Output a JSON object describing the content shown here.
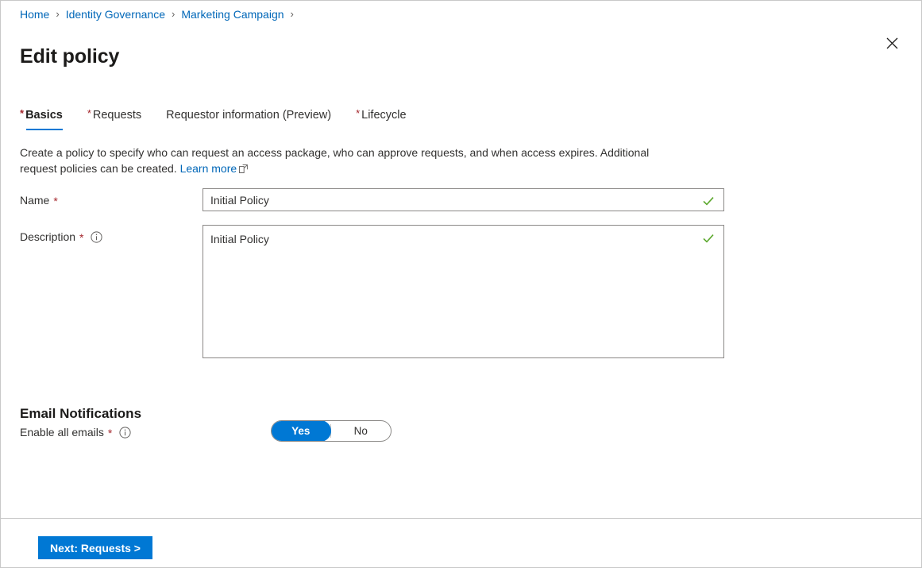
{
  "colors": {
    "accent": "#0078d4",
    "link": "#0067b8",
    "required_asterisk": "#a4262c",
    "valid_green": "#5aa72b",
    "border": "#8a8886",
    "text": "#323130"
  },
  "breadcrumb": {
    "separator": "›",
    "items": [
      {
        "label": "Home"
      },
      {
        "label": "Identity Governance"
      },
      {
        "label": "Marketing Campaign"
      }
    ]
  },
  "header": {
    "title": "Edit policy",
    "close_icon": "close-icon",
    "close_label": "Close"
  },
  "tabs": [
    {
      "label": "Basics",
      "required": "*",
      "active": true
    },
    {
      "label": "Requests",
      "required": "*",
      "active": false
    },
    {
      "label": "Requestor information (Preview)",
      "required": "",
      "active": false
    },
    {
      "label": "Lifecycle",
      "required": "*",
      "active": false
    }
  ],
  "intro": {
    "text": "Create a policy to specify who can request an access package, who can approve requests, and when access expires. Additional request policies can be created.",
    "link_label": "Learn more",
    "link_icon": "external-link-icon"
  },
  "fields": {
    "name": {
      "label": "Name",
      "required": "*",
      "value": "Initial Policy",
      "placeholder": "",
      "valid": true,
      "valid_icon": "checkmark-icon"
    },
    "description": {
      "label": "Description",
      "required": "*",
      "info_icon": "info-icon",
      "value": "Initial Policy",
      "placeholder": "",
      "valid": true,
      "valid_icon": "checkmark-icon"
    }
  },
  "email_notifications": {
    "section_title": "Email Notifications",
    "enable_all": {
      "label": "Enable all emails",
      "required": "*",
      "info_icon": "info-icon",
      "options": [
        {
          "label": "Yes",
          "selected": true
        },
        {
          "label": "No",
          "selected": false
        }
      ]
    }
  },
  "footer": {
    "next_button": "Next: Requests >"
  }
}
